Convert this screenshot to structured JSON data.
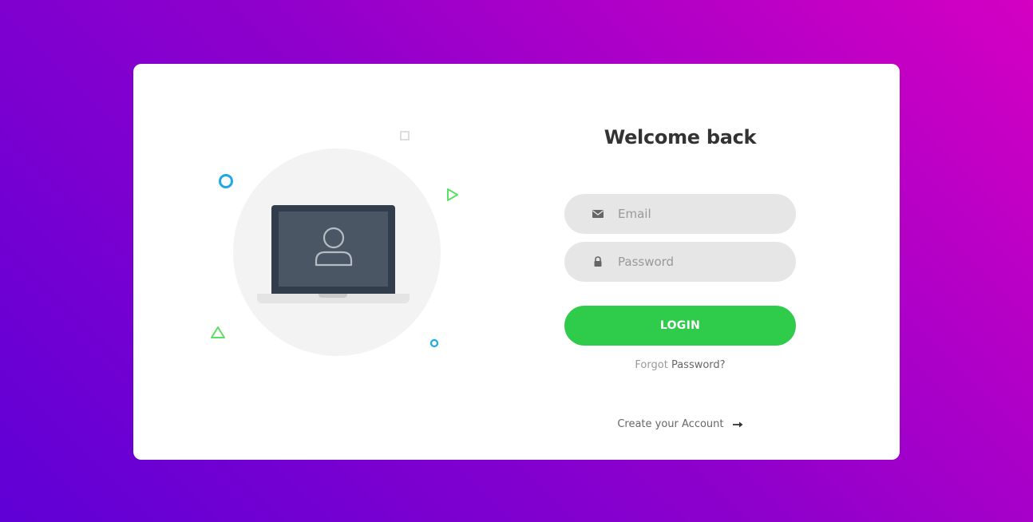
{
  "colors": {
    "gradient_start": "#5f00d6",
    "gradient_end": "#d400c2",
    "card": "#ffffff",
    "login_button": "#2ecc4a",
    "input_background": "#e6e6e6",
    "deco_blue": "#1fa8e6",
    "deco_green": "#5be064"
  },
  "illustration": {
    "icons": [
      "laptop-icon",
      "user-icon",
      "circle-outline-icon",
      "square-outline-icon",
      "triangle-outline-icon",
      "play-triangle-icon"
    ]
  },
  "login": {
    "title": "Welcome back",
    "email": {
      "placeholder": "Email",
      "value": "",
      "icon": "envelope-icon"
    },
    "password": {
      "placeholder": "Password",
      "value": "",
      "icon": "lock-icon"
    },
    "submit_label": "LOGIN",
    "forgot_prefix": "Forgot",
    "forgot_link": "Password?",
    "create_account_label": "Create your Account",
    "create_account_icon": "arrow-right-icon"
  }
}
